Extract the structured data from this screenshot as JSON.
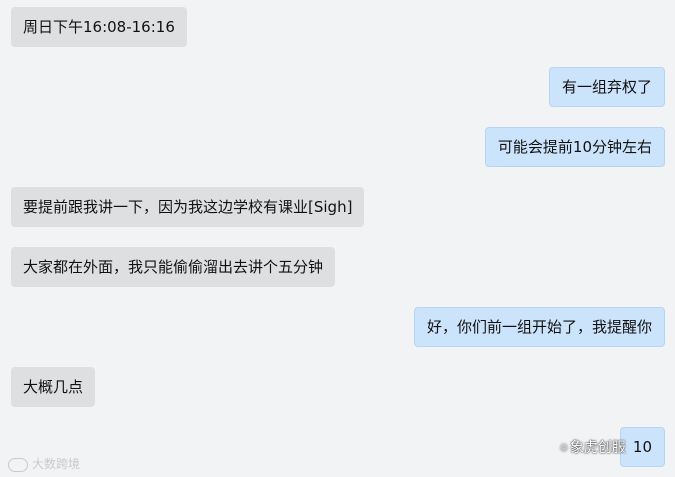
{
  "messages": [
    {
      "side": "left",
      "text": "周日下午16:08-16:16"
    },
    {
      "side": "right",
      "text": "有一组弃权了"
    },
    {
      "side": "right",
      "text": "可能会提前10分钟左右"
    },
    {
      "side": "left",
      "text": "要提前跟我讲一下，因为我这边学校有课业[Sigh]"
    },
    {
      "side": "left",
      "text": "大家都在外面，我只能偷偷溜出去讲个五分钟"
    },
    {
      "side": "right",
      "text": "好，你们前一组开始了，我提醒你"
    },
    {
      "side": "left",
      "text": "大概几点"
    },
    {
      "side": "right",
      "text": "10"
    }
  ],
  "watermarks": {
    "bottom_left": "大数跨境",
    "bottom_right": "象虎创服"
  },
  "colors": {
    "background": "#f2f3f5",
    "incoming_bubble": "#dedfe1",
    "outgoing_bubble": "#cce4fb"
  }
}
